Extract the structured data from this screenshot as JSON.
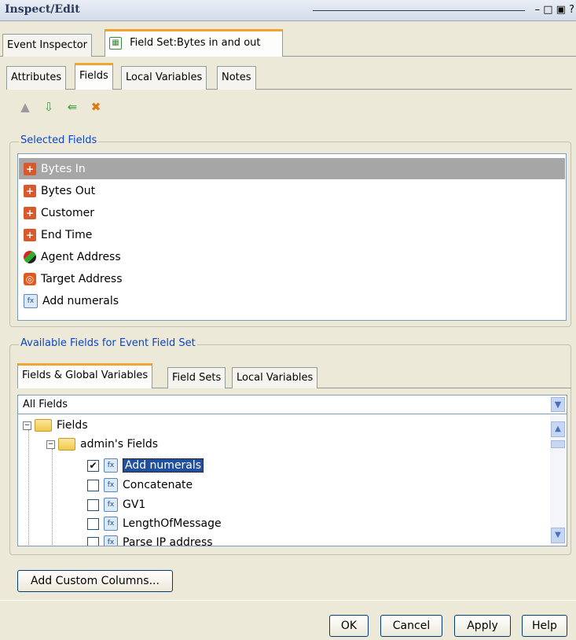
{
  "window": {
    "title": "Inspect/Edit",
    "controls_text": "– □ ▣ ?"
  },
  "main_tabs": [
    {
      "label": "Event Inspector"
    },
    {
      "label": "Field Set:Bytes in and out"
    }
  ],
  "sub_tabs": [
    {
      "label": "Attributes"
    },
    {
      "label": "Fields"
    },
    {
      "label": "Local Variables"
    },
    {
      "label": "Notes"
    }
  ],
  "toolbar": {
    "icons": [
      "move-up-icon",
      "move-down-icon",
      "add-icon",
      "delete-icon"
    ]
  },
  "selected_fields": {
    "legend": "Selected Fields",
    "items": [
      {
        "label": "Bytes In",
        "icon": "field-icon",
        "selected": true
      },
      {
        "label": "Bytes Out",
        "icon": "field-icon"
      },
      {
        "label": "Customer",
        "icon": "field-icon"
      },
      {
        "label": "End Time",
        "icon": "field-icon"
      },
      {
        "label": "Agent Address",
        "icon": "agent-icon"
      },
      {
        "label": "Target Address",
        "icon": "target-icon"
      },
      {
        "label": "Add numerals",
        "icon": "function-icon"
      }
    ]
  },
  "available": {
    "legend": "Available Fields for Event Field Set",
    "tabs": [
      {
        "label": "Fields & Global Variables"
      },
      {
        "label": "Field Sets"
      },
      {
        "label": "Local Variables"
      }
    ],
    "filter_value": "All Fields",
    "tree": {
      "root": "Fields",
      "child": "admin's Fields",
      "items": [
        {
          "label": "Add numerals",
          "checked": true
        },
        {
          "label": "Concatenate",
          "checked": false
        },
        {
          "label": "GV1",
          "checked": false
        },
        {
          "label": "LengthOfMessage",
          "checked": false
        },
        {
          "label": "Parse IP address",
          "checked": false
        }
      ]
    }
  },
  "buttons": {
    "custom_columns": "Add Custom Columns...",
    "ok": "OK",
    "cancel": "Cancel",
    "apply": "Apply",
    "help": "Help"
  }
}
